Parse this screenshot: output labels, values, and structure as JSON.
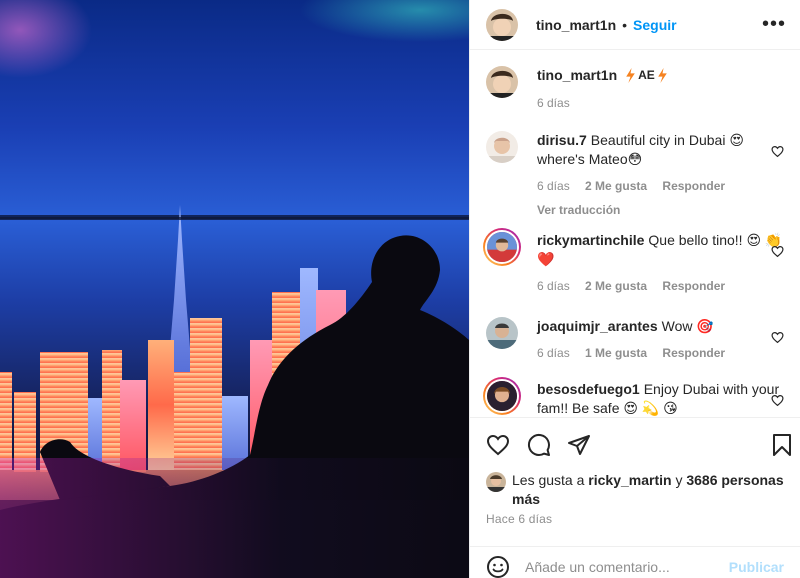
{
  "post": {
    "author": "tino_mart1n",
    "follow_label": "Seguir",
    "more_label": "•••",
    "header_separator": "•"
  },
  "caption": {
    "username": "tino_mart1n",
    "badge": "AE",
    "time": "6 días"
  },
  "comments": [
    {
      "username": "dirisu.7",
      "text": "Beautiful city in Dubai 😍 where's Mateo😳",
      "time": "6 días",
      "likes": "2 Me gusta",
      "reply_label": "Responder",
      "translate_label": "Ver traducción"
    },
    {
      "username": "rickymartinchile",
      "text": "Que bello tino!! 😍 👏❤️",
      "time": "6 días",
      "likes": "2 Me gusta",
      "reply_label": "Responder"
    },
    {
      "username": "joaquimjr_arantes",
      "text": "Wow 🎯",
      "time": "6 días",
      "likes": "1 Me gusta",
      "reply_label": "Responder"
    },
    {
      "username": "besosdefuego1",
      "text": "Enjoy Dubai with your fam!! Be safe 😍 💫 😘"
    }
  ],
  "likes_bar": {
    "prefix": "Les gusta a",
    "user": "ricky_martin",
    "connector": "y",
    "others": "3686 personas más"
  },
  "post_time": "Hace 6 días",
  "add_comment": {
    "placeholder": "Añade un comentario...",
    "publish_label": "Publicar"
  },
  "colors": {
    "accent": "#0095f6",
    "publish_disabled": "#b2dffc",
    "muted": "#8e8e8e",
    "story_ring": "#d6249f"
  },
  "icons": [
    "heart-icon",
    "comment-icon",
    "share-icon",
    "bookmark-icon",
    "emoji-icon",
    "lightning-icon",
    "more-icon"
  ]
}
